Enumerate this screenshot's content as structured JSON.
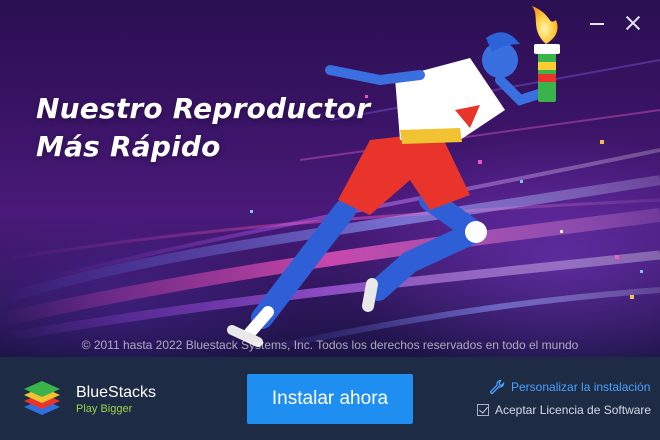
{
  "window": {
    "minimize_icon": "minimize-icon",
    "close_icon": "close-icon"
  },
  "hero": {
    "headline_line1": "Nuestro Reproductor",
    "headline_line2": "Más Rápido",
    "copyright": "© 2011 hasta 2022 Bluestack Systems, Inc. Todos los derechos reservados en todo el mundo"
  },
  "footer": {
    "brand_name": "BlueStacks",
    "brand_tagline": "Play Bigger",
    "install_label": "Instalar ahora",
    "customize_label": "Personalizar la instalación",
    "license_label": "Aceptar Licencia de Software",
    "license_checked": true
  },
  "colors": {
    "accent_button": "#1e8ef1",
    "footer_bg": "#1d2b44",
    "link": "#4aa3ff",
    "tagline": "#9bd24a"
  }
}
